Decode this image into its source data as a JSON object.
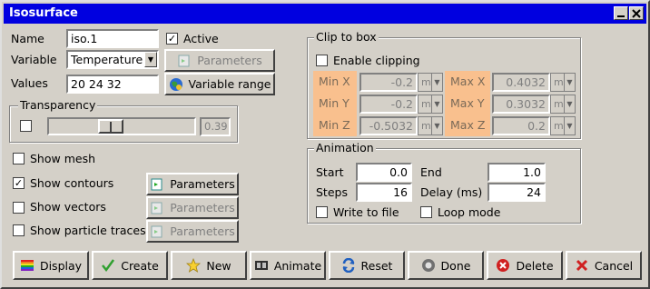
{
  "window": {
    "title": "Isosurface"
  },
  "form": {
    "name_label": "Name",
    "name_value": "iso.1",
    "active_label": "Active",
    "active_checked": true,
    "variable_label": "Variable",
    "variable_value": "Temperature",
    "values_label": "Values",
    "values_value": "20 24 32",
    "parameters_label": "Parameters",
    "variable_range_label": "Variable range"
  },
  "transparency": {
    "group_label": "Transparency",
    "value": "0.39"
  },
  "show": {
    "mesh": "Show mesh",
    "contours": "Show contours",
    "vectors": "Show vectors",
    "particles": "Show particle traces",
    "parameters": "Parameters"
  },
  "clip": {
    "group_label": "Clip to box",
    "enable_label": "Enable clipping",
    "minx_label": "Min X",
    "minx_value": "-0.2",
    "miny_label": "Min Y",
    "miny_value": "-0.2",
    "minz_label": "Min Z",
    "minz_value": "-0.5032",
    "maxx_label": "Max X",
    "maxx_value": "0.4032",
    "maxy_label": "Max Y",
    "maxy_value": "0.3032",
    "maxz_label": "Max Z",
    "maxz_value": "0.2",
    "unit": "m"
  },
  "animation": {
    "group_label": "Animation",
    "start_label": "Start",
    "start_value": "0.0",
    "end_label": "End",
    "end_value": "1.0",
    "steps_label": "Steps",
    "steps_value": "16",
    "delay_label": "Delay (ms)",
    "delay_value": "24",
    "write_label": "Write to file",
    "loop_label": "Loop mode"
  },
  "buttons": {
    "display": "Display",
    "create": "Create",
    "new": "New",
    "animate": "Animate",
    "reset": "Reset",
    "done": "Done",
    "delete": "Delete",
    "cancel": "Cancel"
  }
}
